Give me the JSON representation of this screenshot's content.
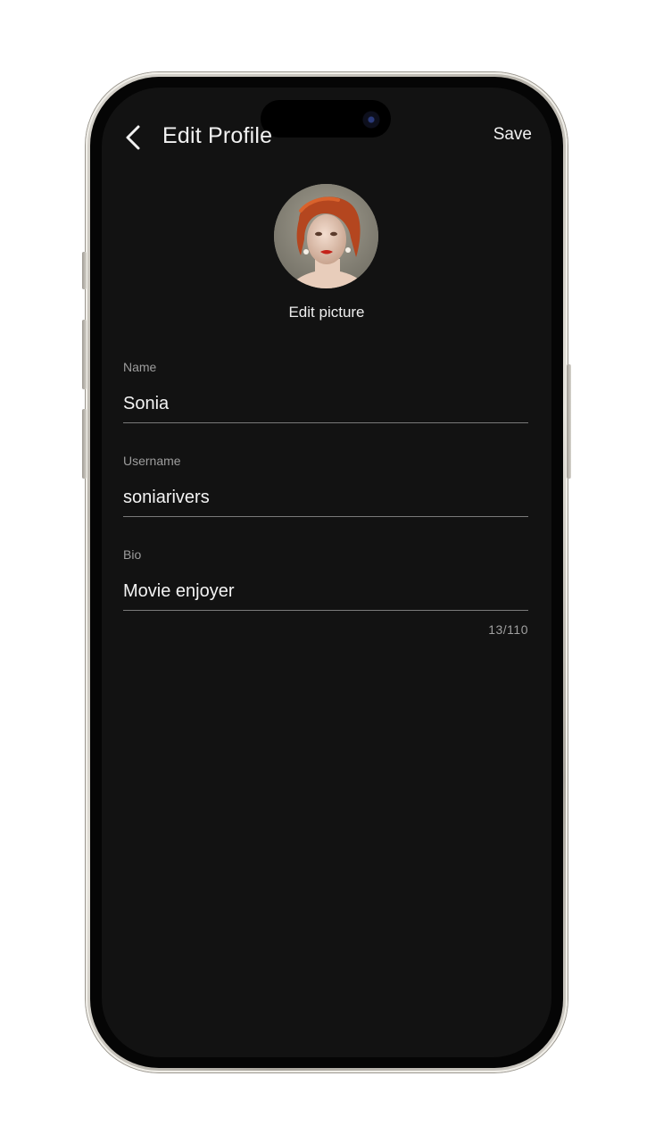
{
  "header": {
    "title": "Edit Profile",
    "back_icon": "chevron-left-icon",
    "save_label": "Save"
  },
  "avatar": {
    "edit_label": "Edit picture"
  },
  "form": {
    "name": {
      "label": "Name",
      "value": "Sonia"
    },
    "username": {
      "label": "Username",
      "value": "soniarivers"
    },
    "bio": {
      "label": "Bio",
      "value": "Movie enjoyer",
      "counter": "13/110"
    }
  },
  "colors": {
    "screen_background": "#121212",
    "text_primary": "#f2f2f2",
    "text_secondary": "#9d9d9d",
    "divider": "#7a7a7a"
  }
}
